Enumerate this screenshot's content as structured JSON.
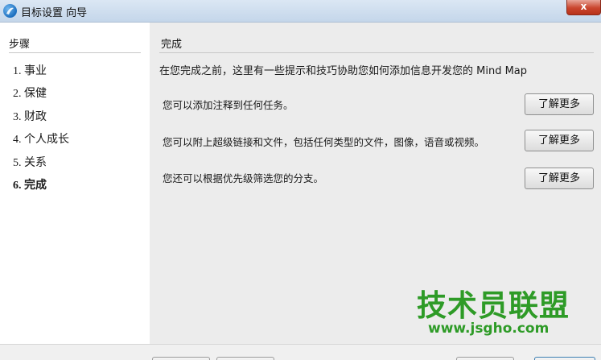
{
  "window": {
    "title": "目标设置 向导",
    "close_glyph": "x"
  },
  "sidebar": {
    "header": "步骤",
    "items": [
      {
        "label": "1. 事业",
        "current": false
      },
      {
        "label": "2. 保健",
        "current": false
      },
      {
        "label": "3. 财政",
        "current": false
      },
      {
        "label": "4. 个人成长",
        "current": false
      },
      {
        "label": "5. 关系",
        "current": false
      },
      {
        "label": "6. 完成",
        "current": true
      }
    ]
  },
  "main": {
    "section_title": "完成",
    "intro": "在您完成之前，这里有一些提示和技巧协助您如何添加信息开发您的 Mind Map",
    "tips": [
      {
        "text": "您可以添加注释到任何任务。",
        "button": "了解更多"
      },
      {
        "text": "您可以附上超级链接和文件，包括任何类型的文件，图像，语音或视频。",
        "button": "了解更多"
      },
      {
        "text": "您还可以根据优先级筛选您的分支。",
        "button": "了解更多"
      }
    ]
  },
  "watermark": {
    "text": "技术员联盟",
    "url": "www.jsgho.com"
  },
  "colors": {
    "watermark": "#2e9b27",
    "right_pane_bg": "#ececec",
    "titlebar_bg": "#c4d6ea"
  }
}
